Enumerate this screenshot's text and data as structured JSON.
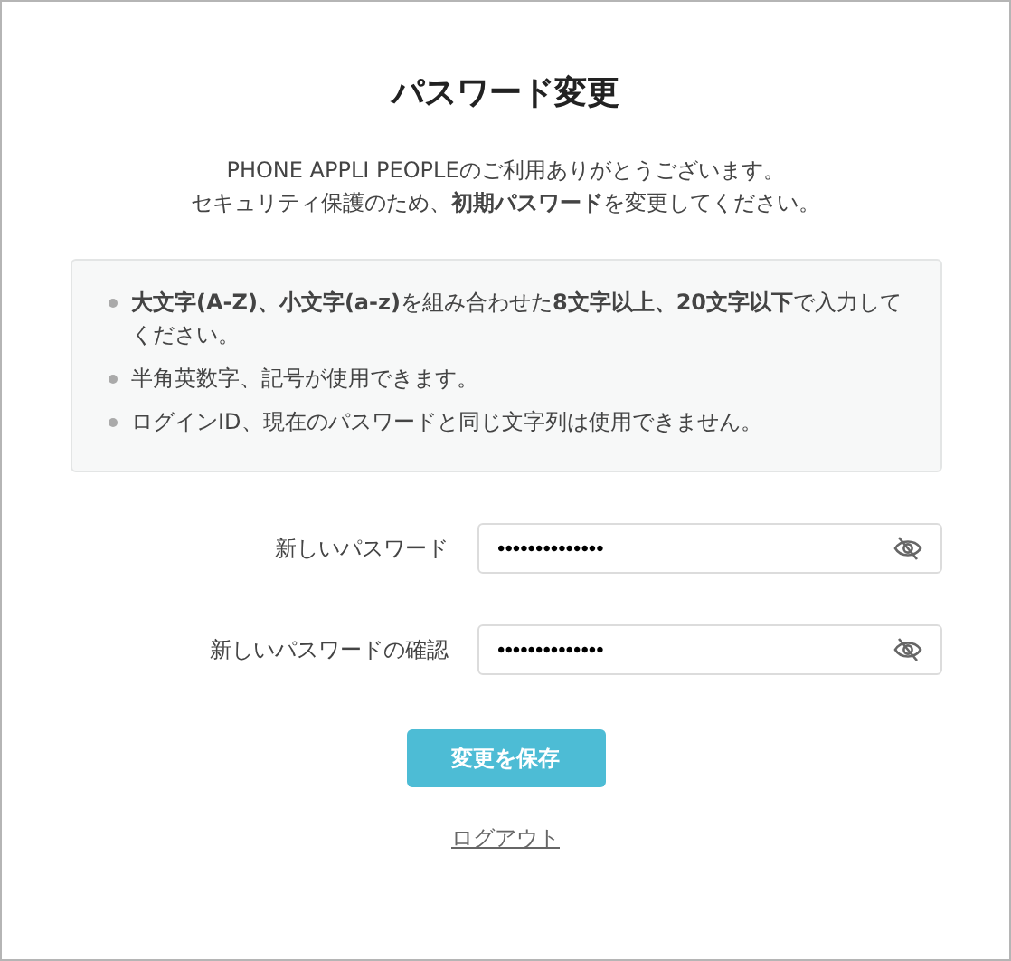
{
  "title": "パスワード変更",
  "intro": [
    "PHONE APPLI PEOPLEのご利用ありがとうございます。",
    "セキュリティ保護のため、**初期パスワード**を変更してください。"
  ],
  "rules": [
    "**大文字(A-Z)、小文字(a-z)**を組み合わせた**8文字以上、20文字以下**で入力してください。",
    "半角英数字、記号が使用できます。",
    "ログインID、現在のパスワードと同じ文字列は使用できません。"
  ],
  "fields": [
    {
      "label": "新しいパスワード",
      "value": "••••••••••••••"
    },
    {
      "label": "新しいパスワードの確認",
      "value": "••••••••••••••"
    }
  ],
  "save_button": "変更を保存",
  "logout_link": "ログアウト"
}
